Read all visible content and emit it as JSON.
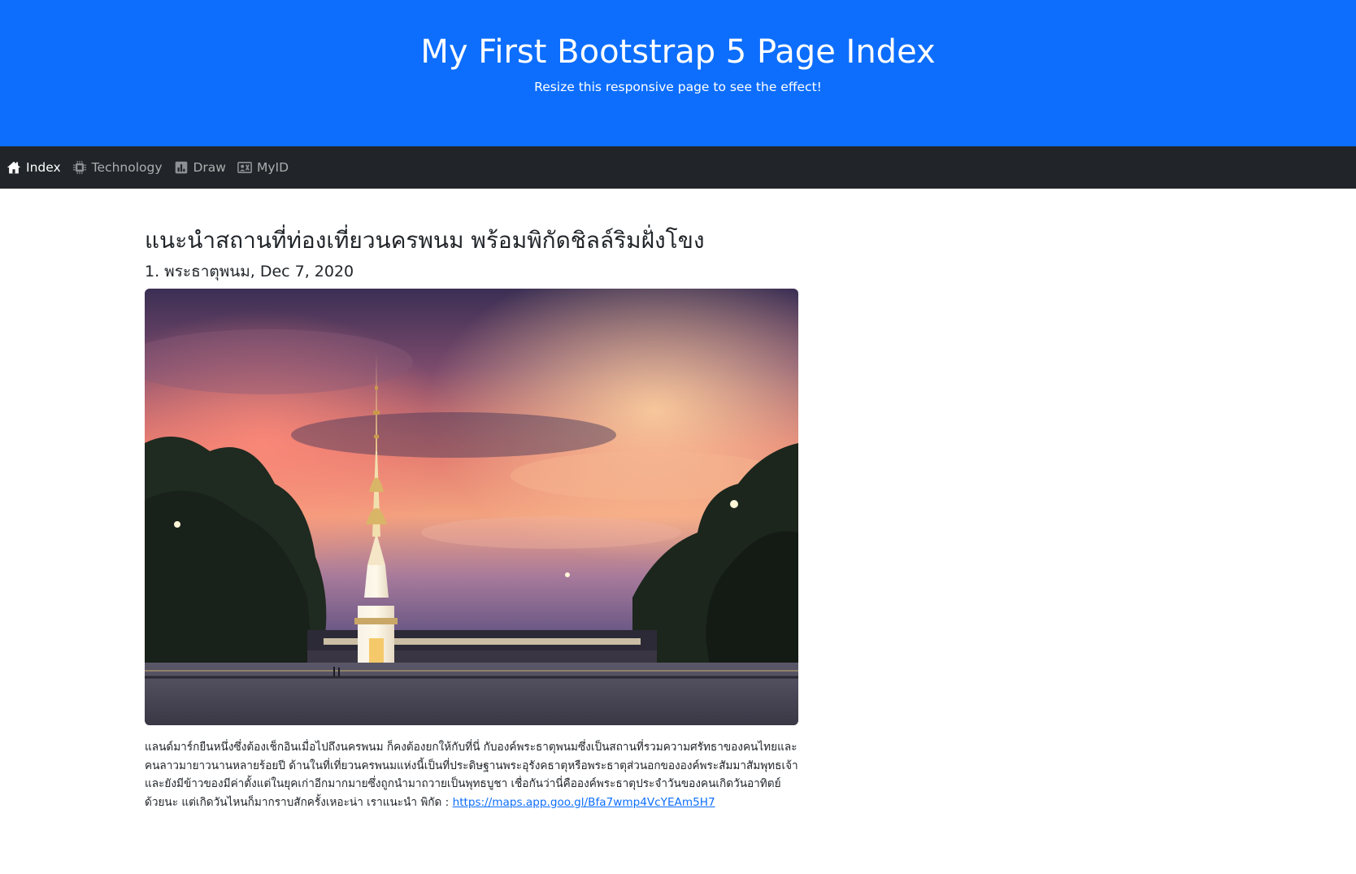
{
  "header": {
    "title": "My First Bootstrap 5 Page Index",
    "subtitle": "Resize this responsive page to see the effect!",
    "bg_color": "#0d6efd"
  },
  "navbar": {
    "items": [
      {
        "label": "Index",
        "icon": "house-icon",
        "active": true
      },
      {
        "label": "Technology",
        "icon": "cpu-icon",
        "active": false
      },
      {
        "label": "Draw",
        "icon": "bar-chart-icon",
        "active": false
      },
      {
        "label": "MyID",
        "icon": "person-badge-icon",
        "active": false
      }
    ],
    "bg_color": "#212529"
  },
  "article": {
    "heading": "แนะนำสถานที่ท่องเที่ยวนครพนม พร้อมพิกัดชิลล์ริมฝั่งโขง",
    "subheading": "1. พระธาตุพนม, Dec 7, 2020",
    "body": "แลนด์มาร์กยืนหนึ่งซึ่งต้องเช็กอินเมื่อไปถึงนครพนม ก็คงต้องยกให้กับที่นี่ กับองค์พระธาตุพนมซึ่งเป็นสถานที่รวมความศรัทธาของคนไทยและคนลาวมายาวนานหลายร้อยปี ด้านในที่เที่ยวนครพนมแห่งนี้เป็นที่ประดิษฐานพระอุรังคธาตุหรือพระธาตุส่วนอกขององค์พระสัมมาสัมพุทธเจ้า และยังมีข้าวของมีค่าตั้งแต่ในยุคเก่าอีกมากมายซึ่งถูกนำมาถวายเป็นพุทธบูชา เชื่อกันว่านี่คือองค์พระธาตุประจำวันของคนเกิดวันอาทิตย์ด้วยนะ แต่เกิดวันไหนก็มากราบสักครั้งเหอะน่า เราแนะนำ พิกัด : ",
    "link_text": "https://maps.app.goo.gl/Bfa7wmp4VcYEAm5H7",
    "link_color": "#0d6efd"
  }
}
